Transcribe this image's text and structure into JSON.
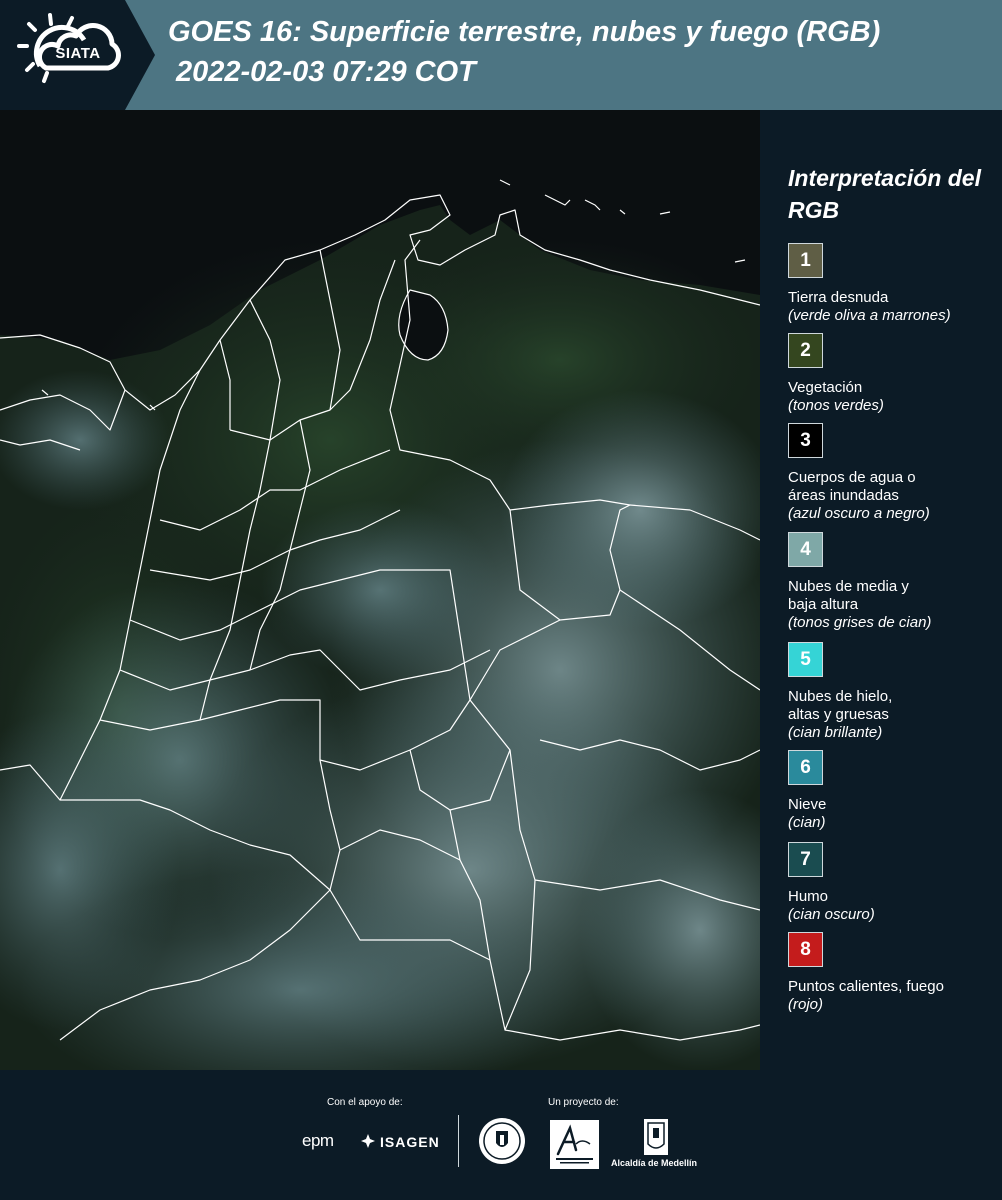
{
  "header": {
    "logo_text": "SIATA",
    "title_line1": "GOES 16: Superficie terrestre, nubes y fuego (RGB)",
    "title_line2": "2022-02-03 07:29 COT",
    "header_color": "#4d7583",
    "logo_panel_color": "#0c1b26"
  },
  "legend": {
    "title": "Interpretación del RGB",
    "items": [
      {
        "number": "1",
        "color": "#5f5e45",
        "label": "Tierra desnuda",
        "desc": "(verde oliva a marrones)"
      },
      {
        "number": "2",
        "color": "#34461f",
        "label": "Vegetación",
        "desc": "(tonos verdes)"
      },
      {
        "number": "3",
        "color": "#000000",
        "label": "Cuerpos de agua o áreas inundadas",
        "desc": "(azul oscuro a negro)"
      },
      {
        "number": "4",
        "color": "#7fa8a7",
        "label": "Nubes de media y baja altura",
        "desc": "(tonos grises de cian)"
      },
      {
        "number": "5",
        "color": "#35d4d6",
        "label": "Nubes de hielo, altas y gruesas",
        "desc": "(cian brillante)"
      },
      {
        "number": "6",
        "color": "#2a8a9c",
        "label": "Nieve",
        "desc": "(cian)"
      },
      {
        "number": "7",
        "color": "#1a4c50",
        "label": "Humo",
        "desc": "(cian oscuro)"
      },
      {
        "number": "8",
        "color": "#c41c1c",
        "label": "Puntos calientes, fuego",
        "desc": "(rojo)"
      }
    ]
  },
  "footer": {
    "support_label": "Con el apoyo de:",
    "project_label": "Un proyecto de:",
    "sponsor_epm": "epm",
    "sponsor_isagen": "ISAGEN",
    "alcaldia": "Alcaldía de Medellín"
  },
  "map": {
    "ocean_color": "#0b0f11",
    "land_color": "#1c2a22",
    "cloud_color": "#5d7f86",
    "border_color": "#ffffff"
  }
}
